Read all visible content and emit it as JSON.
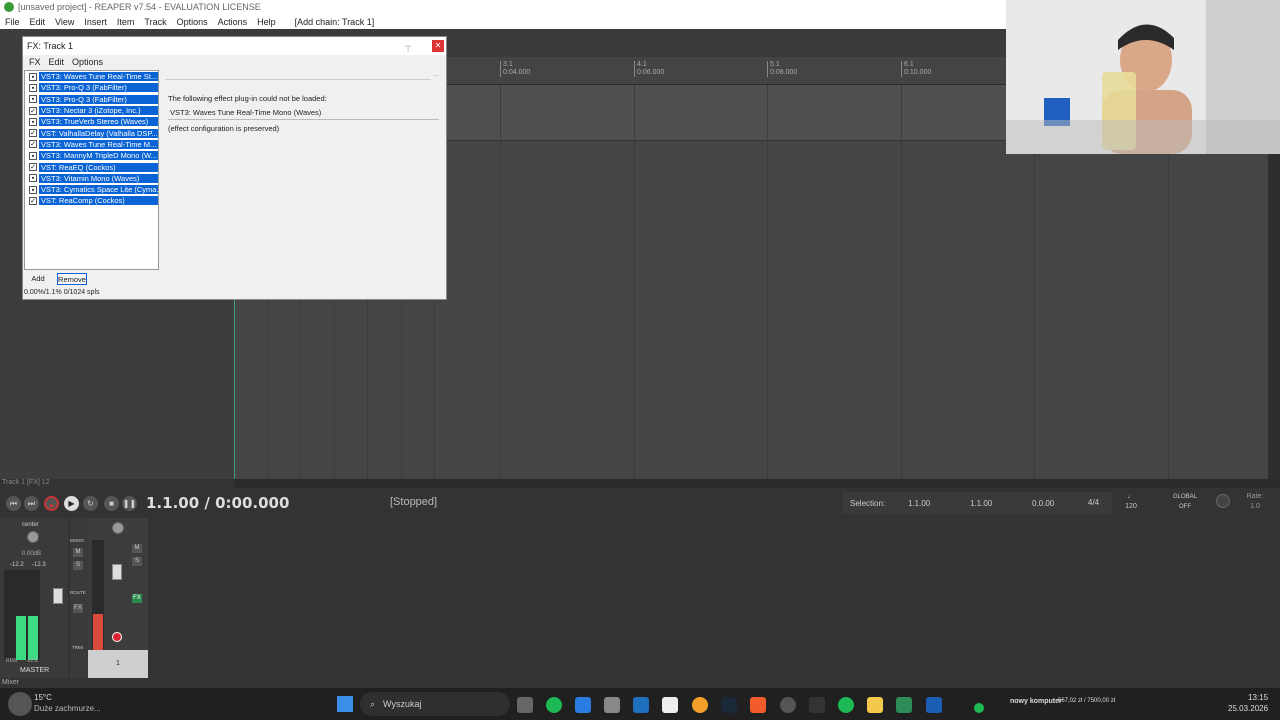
{
  "window": {
    "title": "[unsaved project] - REAPER v7.54 - EVALUATION LICENSE"
  },
  "menubar": {
    "items": [
      "File",
      "Edit",
      "View",
      "Insert",
      "Item",
      "Track",
      "Options",
      "Actions",
      "Help",
      "[Add chain: Track 1]"
    ]
  },
  "ruler": {
    "marks": [
      {
        "bar": "3.1",
        "time": "0:04.000"
      },
      {
        "bar": "4.1",
        "time": "0:06.000"
      },
      {
        "bar": "5.1",
        "time": "0:08.000"
      },
      {
        "bar": "6.1",
        "time": "0:10.000"
      }
    ]
  },
  "fx_window": {
    "title": "FX: Track 1",
    "menu": [
      "FX",
      "Edit",
      "Options"
    ],
    "fx_list": [
      {
        "name": "VST3: Waves Tune Real-Time St...",
        "enabled": false
      },
      {
        "name": "VST3: Pro-Q 3 (FabFilter)",
        "enabled": false
      },
      {
        "name": "VST3: Pro-Q 3 (FabFilter)",
        "enabled": false
      },
      {
        "name": "VST3: Nectar 3 (iZotope, Inc.)",
        "enabled": true
      },
      {
        "name": "VST3: TrueVerb Stereo (Waves)",
        "enabled": false
      },
      {
        "name": "VST: ValhallaDelay (Valhalla DSP...",
        "enabled": true
      },
      {
        "name": "VST3: Waves Tune Real-Time M...",
        "enabled": true
      },
      {
        "name": "VST3: MannyM TripleD Mono (W...",
        "enabled": false
      },
      {
        "name": "VST: ReaEQ (Cockos)",
        "enabled": true
      },
      {
        "name": "VST3: Vitamin Mono (Waves)",
        "enabled": false
      },
      {
        "name": "VST3: Cymatics Space Lite (Cyma...",
        "enabled": false
      },
      {
        "name": "VST: ReaComp (Cockos)",
        "enabled": true
      }
    ],
    "message_line1": "The following effect plug-in could not be loaded:",
    "message_plugin": "VST3: Waves Tune Real-Time Mono (Waves)",
    "message_line3": "(effect configuration is preserved)",
    "add_label": "Add",
    "remove_label": "Remove",
    "cpu_status": "0.00%/1.1% 0/1024 spls",
    "more_label": "..."
  },
  "status_line": "Track 1 [FX] 12",
  "transport": {
    "position": "1.1.00 / 0:00.000",
    "state": "[Stopped]",
    "selection_label": "Selection:",
    "selection_start": "1.1.00",
    "selection_end": "1.1.00",
    "selection_length": "0.0.00",
    "time_signature": "4/4",
    "bpm": "120",
    "global_label": "GLOBAL",
    "global_value": "OFF",
    "rate_label": "Rate:",
    "rate_value": "1.0"
  },
  "mixer": {
    "master_pan": "center",
    "master_vol": "0.00dB",
    "master_peak_l": "-12.2",
    "master_peak_r": "-12.3",
    "master_label": "MASTER",
    "rms_label": "RMS",
    "rms_value": "-22.8",
    "mono_label": "MONO",
    "route_label": "ROUTE",
    "trim_label": "TRIM",
    "fx_label": "FX",
    "m_label": "M",
    "s_label": "S",
    "mixer_tab": "Mixer",
    "track_number": "1"
  },
  "taskbar": {
    "weather_temp": "15°C",
    "weather_desc": "Duże zachmurze...",
    "search_placeholder": "Wyszukaj",
    "notification": "nowy komputer",
    "stats": "567,02 zł / 7500,00 zł",
    "time": "13:15",
    "date": "25.03.2026"
  },
  "colors": {
    "selection": "#0a64d6",
    "meter_green": "#3ddc84",
    "record_red": "#cc3333"
  }
}
